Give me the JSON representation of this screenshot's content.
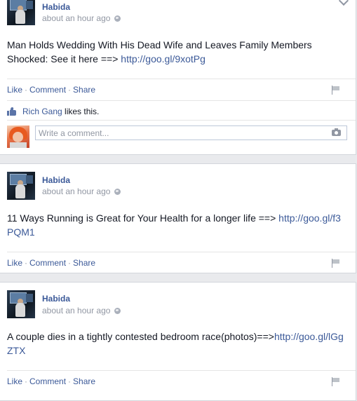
{
  "posts": [
    {
      "author": "Habida",
      "time": "about an hour ago",
      "text": "Man Holds Wedding With His Dead Wife and Leaves Family Members Shocked: See it here ==> ",
      "link": "http://goo.gl/9xotPg",
      "actions": {
        "like": "Like",
        "comment": "Comment",
        "share": "Share"
      },
      "likes": {
        "liker": "Rich Gang",
        "suffix": " likes this."
      },
      "comment_placeholder": "Write a comment..."
    },
    {
      "author": "Habida",
      "time": "about an hour ago",
      "text": "11 Ways Running is Great for Your Health for a longer life ==> ",
      "link": "http://goo.gl/f3PQM1",
      "actions": {
        "like": "Like",
        "comment": "Comment",
        "share": "Share"
      }
    },
    {
      "author": "Habida",
      "time": "about an hour ago",
      "text": "A couple dies in a tightly contested bedroom race(photos)==>",
      "link": "http://goo.gl/lGgZTX",
      "actions": {
        "like": "Like",
        "comment": "Comment",
        "share": "Share"
      }
    }
  ],
  "separator": "·",
  "icons": {
    "avatar": "profile-photo",
    "globe": "globe-icon",
    "flag": "flag-icon",
    "thumb": "thumbs-up-icon",
    "camera": "camera-icon",
    "chevron": "chevron-down-icon"
  },
  "colors": {
    "link": "#3b5998",
    "meta": "#9197a3",
    "background": "#e9eaed"
  }
}
